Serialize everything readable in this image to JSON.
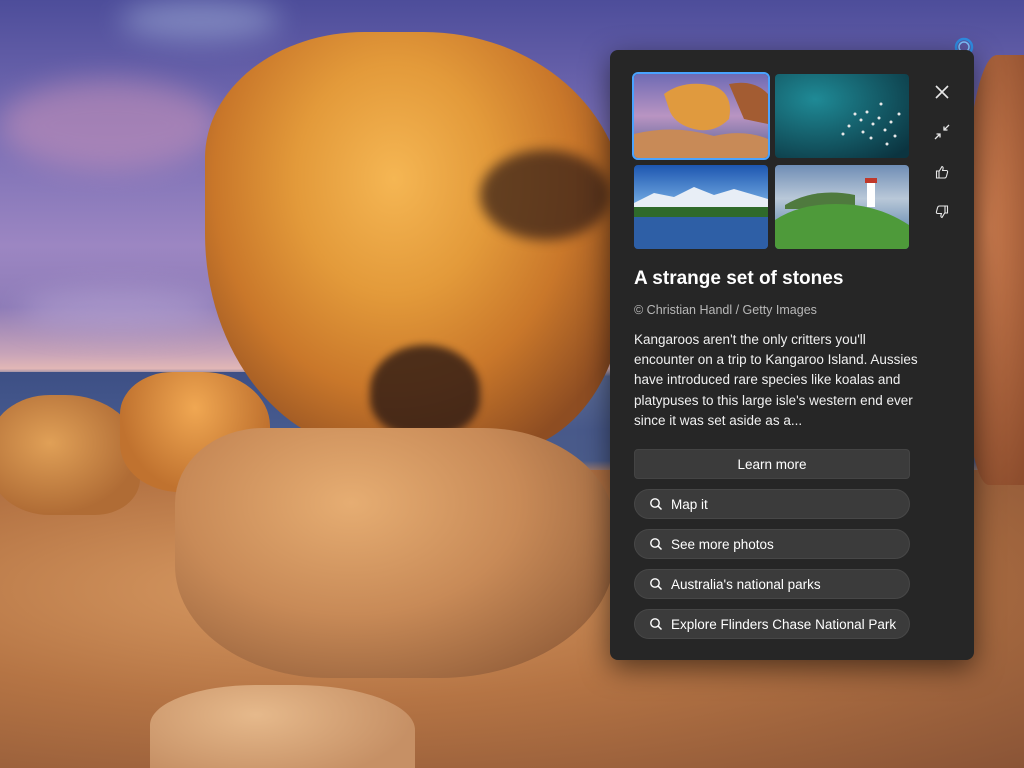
{
  "wallpaper": {
    "description_icon": "status-ring-icon"
  },
  "panel": {
    "thumbnails": [
      {
        "name": "remarkable-rocks-thumb",
        "selected": true
      },
      {
        "name": "underwater-fish-thumb",
        "selected": false
      },
      {
        "name": "mountain-lake-thumb",
        "selected": false
      },
      {
        "name": "lighthouse-cliff-thumb",
        "selected": false
      }
    ],
    "actions": [
      "close-icon",
      "minimize-icon",
      "thumbs-up-icon",
      "thumbs-down-icon"
    ],
    "title": "A strange set of stones",
    "credit": "© Christian Handl / Getty Images",
    "description": "Kangaroos aren't the only critters you'll encounter on a trip to Kangaroo Island. Aussies have introduced rare species like koalas and platypuses to this large isle's western end ever since it was set aside as a...",
    "learn_more": "Learn more",
    "chips": [
      {
        "label": "Map it",
        "icon": "search-icon"
      },
      {
        "label": "See more photos",
        "icon": "search-icon"
      },
      {
        "label": "Australia's national parks",
        "icon": "search-icon"
      },
      {
        "label": "Explore Flinders Chase National Park",
        "icon": "search-icon"
      }
    ]
  },
  "colors": {
    "panel_bg": "#262626",
    "accent": "#4aa3ff",
    "chip_bg": "#3b3b3b"
  }
}
